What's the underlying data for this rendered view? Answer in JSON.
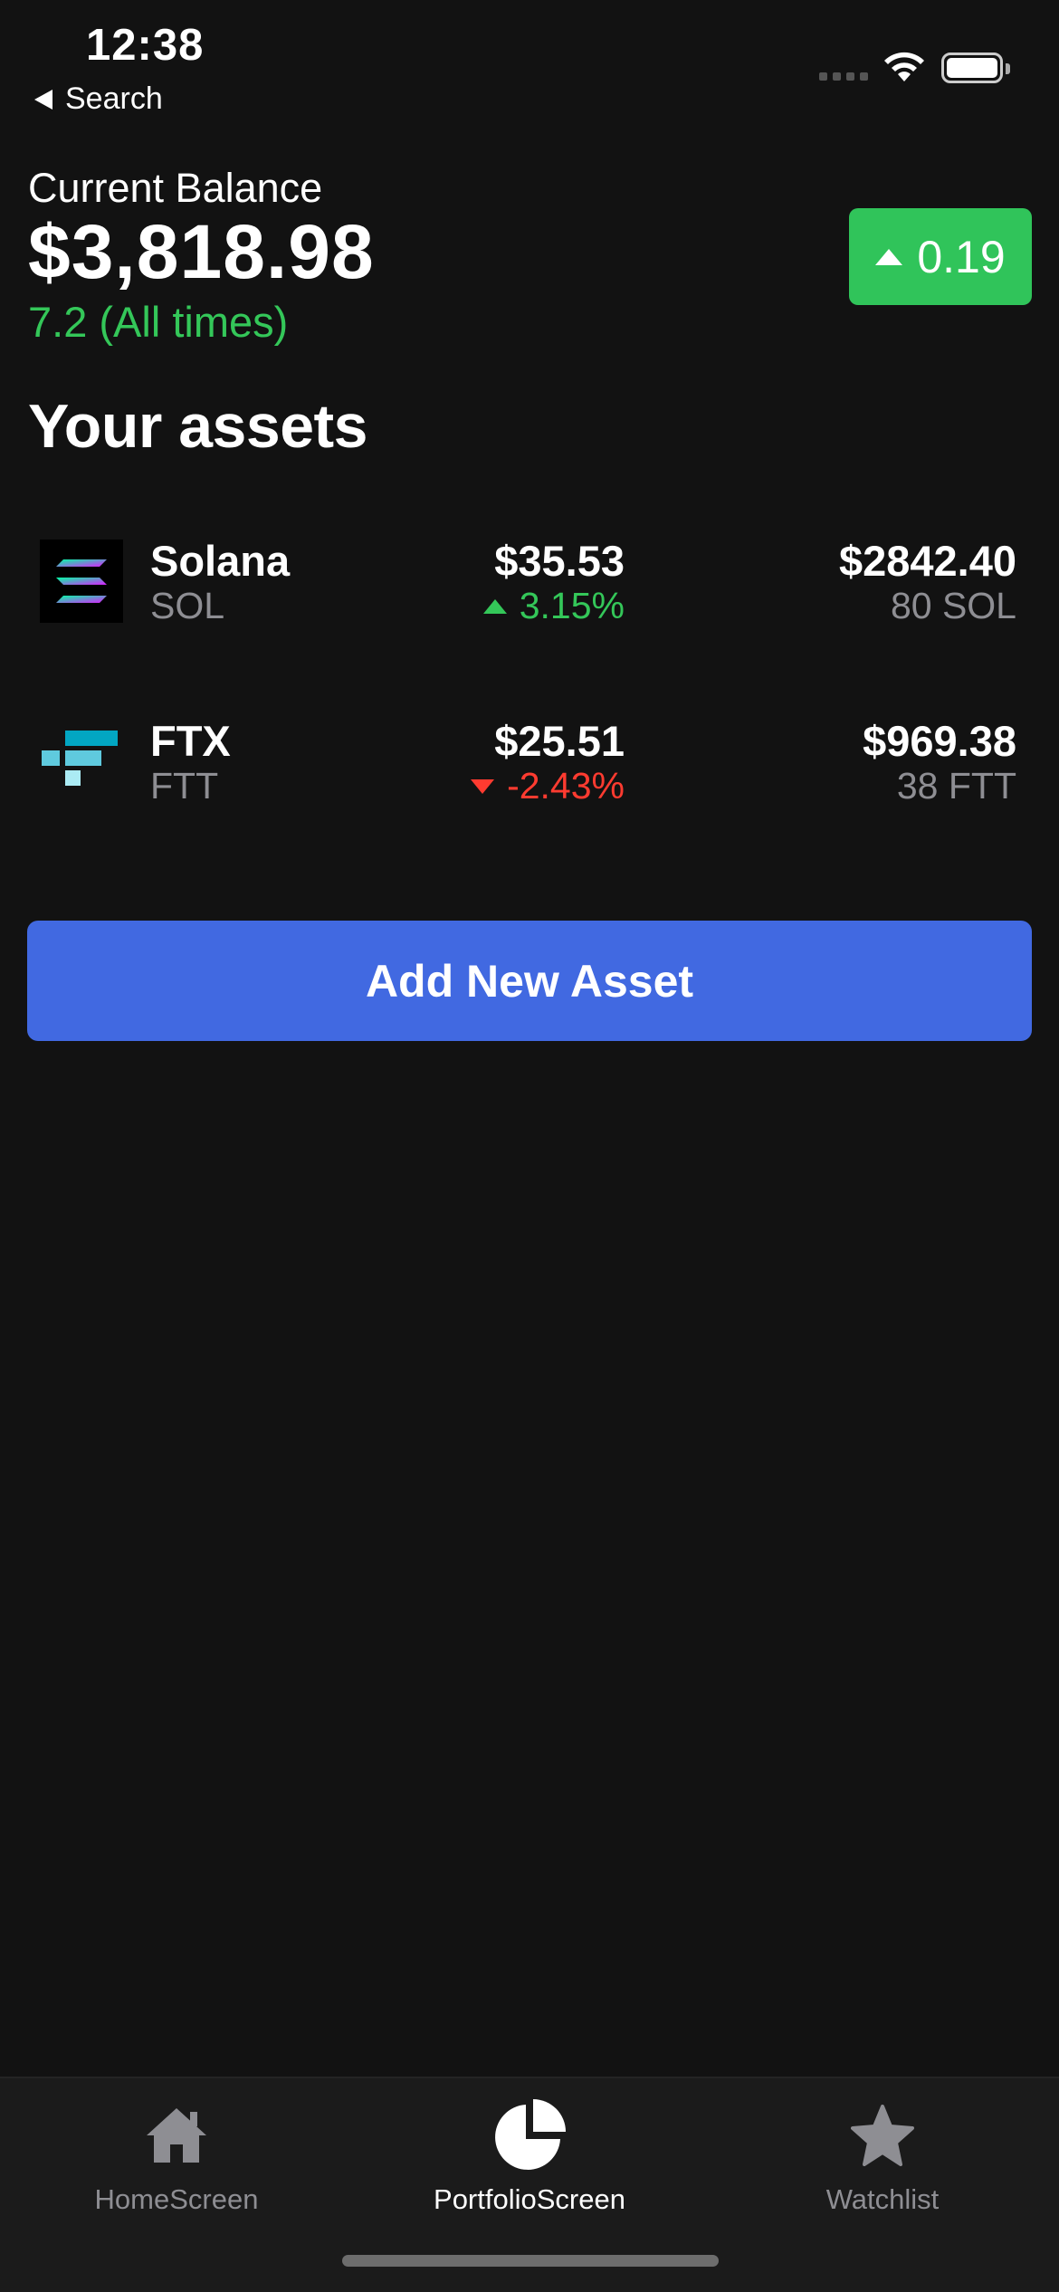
{
  "status_bar": {
    "time": "12:38",
    "back_label": "Search"
  },
  "balance": {
    "label": "Current Balance",
    "value": "$3,818.98",
    "change_all_time": "7.2 (All times)",
    "change_badge": "0.19"
  },
  "assets_section": {
    "title": "Your assets",
    "items": [
      {
        "name": "Solana",
        "symbol": "SOL",
        "price": "$35.53",
        "change": "3.15%",
        "direction": "up",
        "value": "$2842.40",
        "quantity": "80 SOL",
        "icon": "solana-logo-icon"
      },
      {
        "name": "FTX",
        "symbol": "FTT",
        "price": "$25.51",
        "change": "-2.43%",
        "direction": "down",
        "value": "$969.38",
        "quantity": "38 FTT",
        "icon": "ftx-logo-icon"
      }
    ]
  },
  "add_button_label": "Add New Asset",
  "tab_bar": {
    "tabs": [
      {
        "label": "HomeScreen",
        "icon": "home-icon",
        "active": false
      },
      {
        "label": "PortfolioScreen",
        "icon": "pie-chart-icon",
        "active": true
      },
      {
        "label": "Watchlist",
        "icon": "star-icon",
        "active": false
      }
    ]
  },
  "colors": {
    "background": "#121212",
    "positive": "#34c759",
    "negative": "#ff3b30",
    "badge": "#30c45a",
    "button": "#4169e1",
    "tab_bar": "#1b1b1b",
    "muted_text": "#8e8e93"
  }
}
